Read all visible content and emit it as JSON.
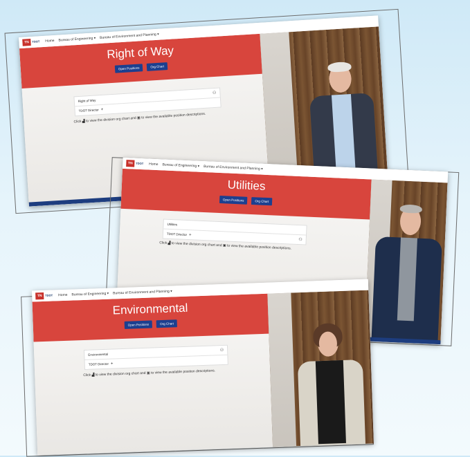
{
  "nav": {
    "logo_badge": "TN",
    "logo_text": "TDOT",
    "home": "Home",
    "bureau_engineering": "Bureau of Engineering ▾",
    "bureau_environment": "Bureau of Environment and Planning ▾"
  },
  "buttons": {
    "open_positions": "Open Positions",
    "org_chart": "Org Chart"
  },
  "panels": [
    {
      "title": "Right of Way",
      "division": "Right of Way",
      "director": "TDOT Director"
    },
    {
      "title": "Utilities",
      "division": "Utilities",
      "director": "TDOT Director"
    },
    {
      "title": "Environmental",
      "division": "Environmental",
      "director": "TDOT Director"
    }
  ],
  "hint": "Click ▟ to view the division org chart and ▣ to view the available position descriptions.",
  "colors": {
    "banner": "#d8453d",
    "button": "#1c3f8f",
    "footer": "#1d3d7f",
    "brand": "#c8312b"
  },
  "icons": {
    "org_chart": "org-chart-icon",
    "document": "document-icon",
    "expand": "plus-icon"
  }
}
